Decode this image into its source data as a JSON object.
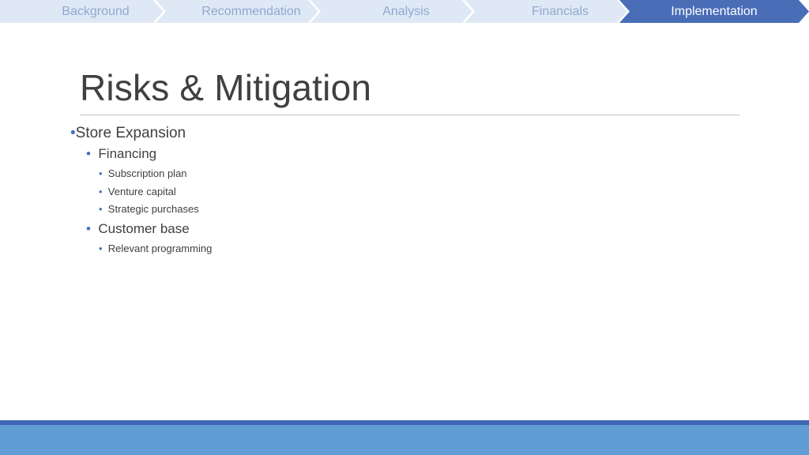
{
  "nav": {
    "steps": [
      {
        "label": "Background",
        "active": false
      },
      {
        "label": "Recommendation",
        "active": false
      },
      {
        "label": "Analysis",
        "active": false
      },
      {
        "label": "Financials",
        "active": false
      },
      {
        "label": "Implementation",
        "active": true
      }
    ]
  },
  "slide": {
    "title": "Risks & Mitigation",
    "bullets": {
      "store_expansion": "Store Expansion",
      "financing": "Financing",
      "subscription_plan": "Subscription plan",
      "venture_capital": "Venture capital",
      "strategic_purchases": "Strategic purchases",
      "customer_base": "Customer base",
      "relevant_programming": "Relevant programming"
    }
  },
  "colors": {
    "nav_inactive": "#dfe8f5",
    "nav_active": "#4a6db8",
    "nav_text": "#8fa9d0",
    "bullet_accent": "#4472c4",
    "footer": "#5f9dd4"
  },
  "icons": {
    "nav_separator": "chevron-right-icon"
  }
}
